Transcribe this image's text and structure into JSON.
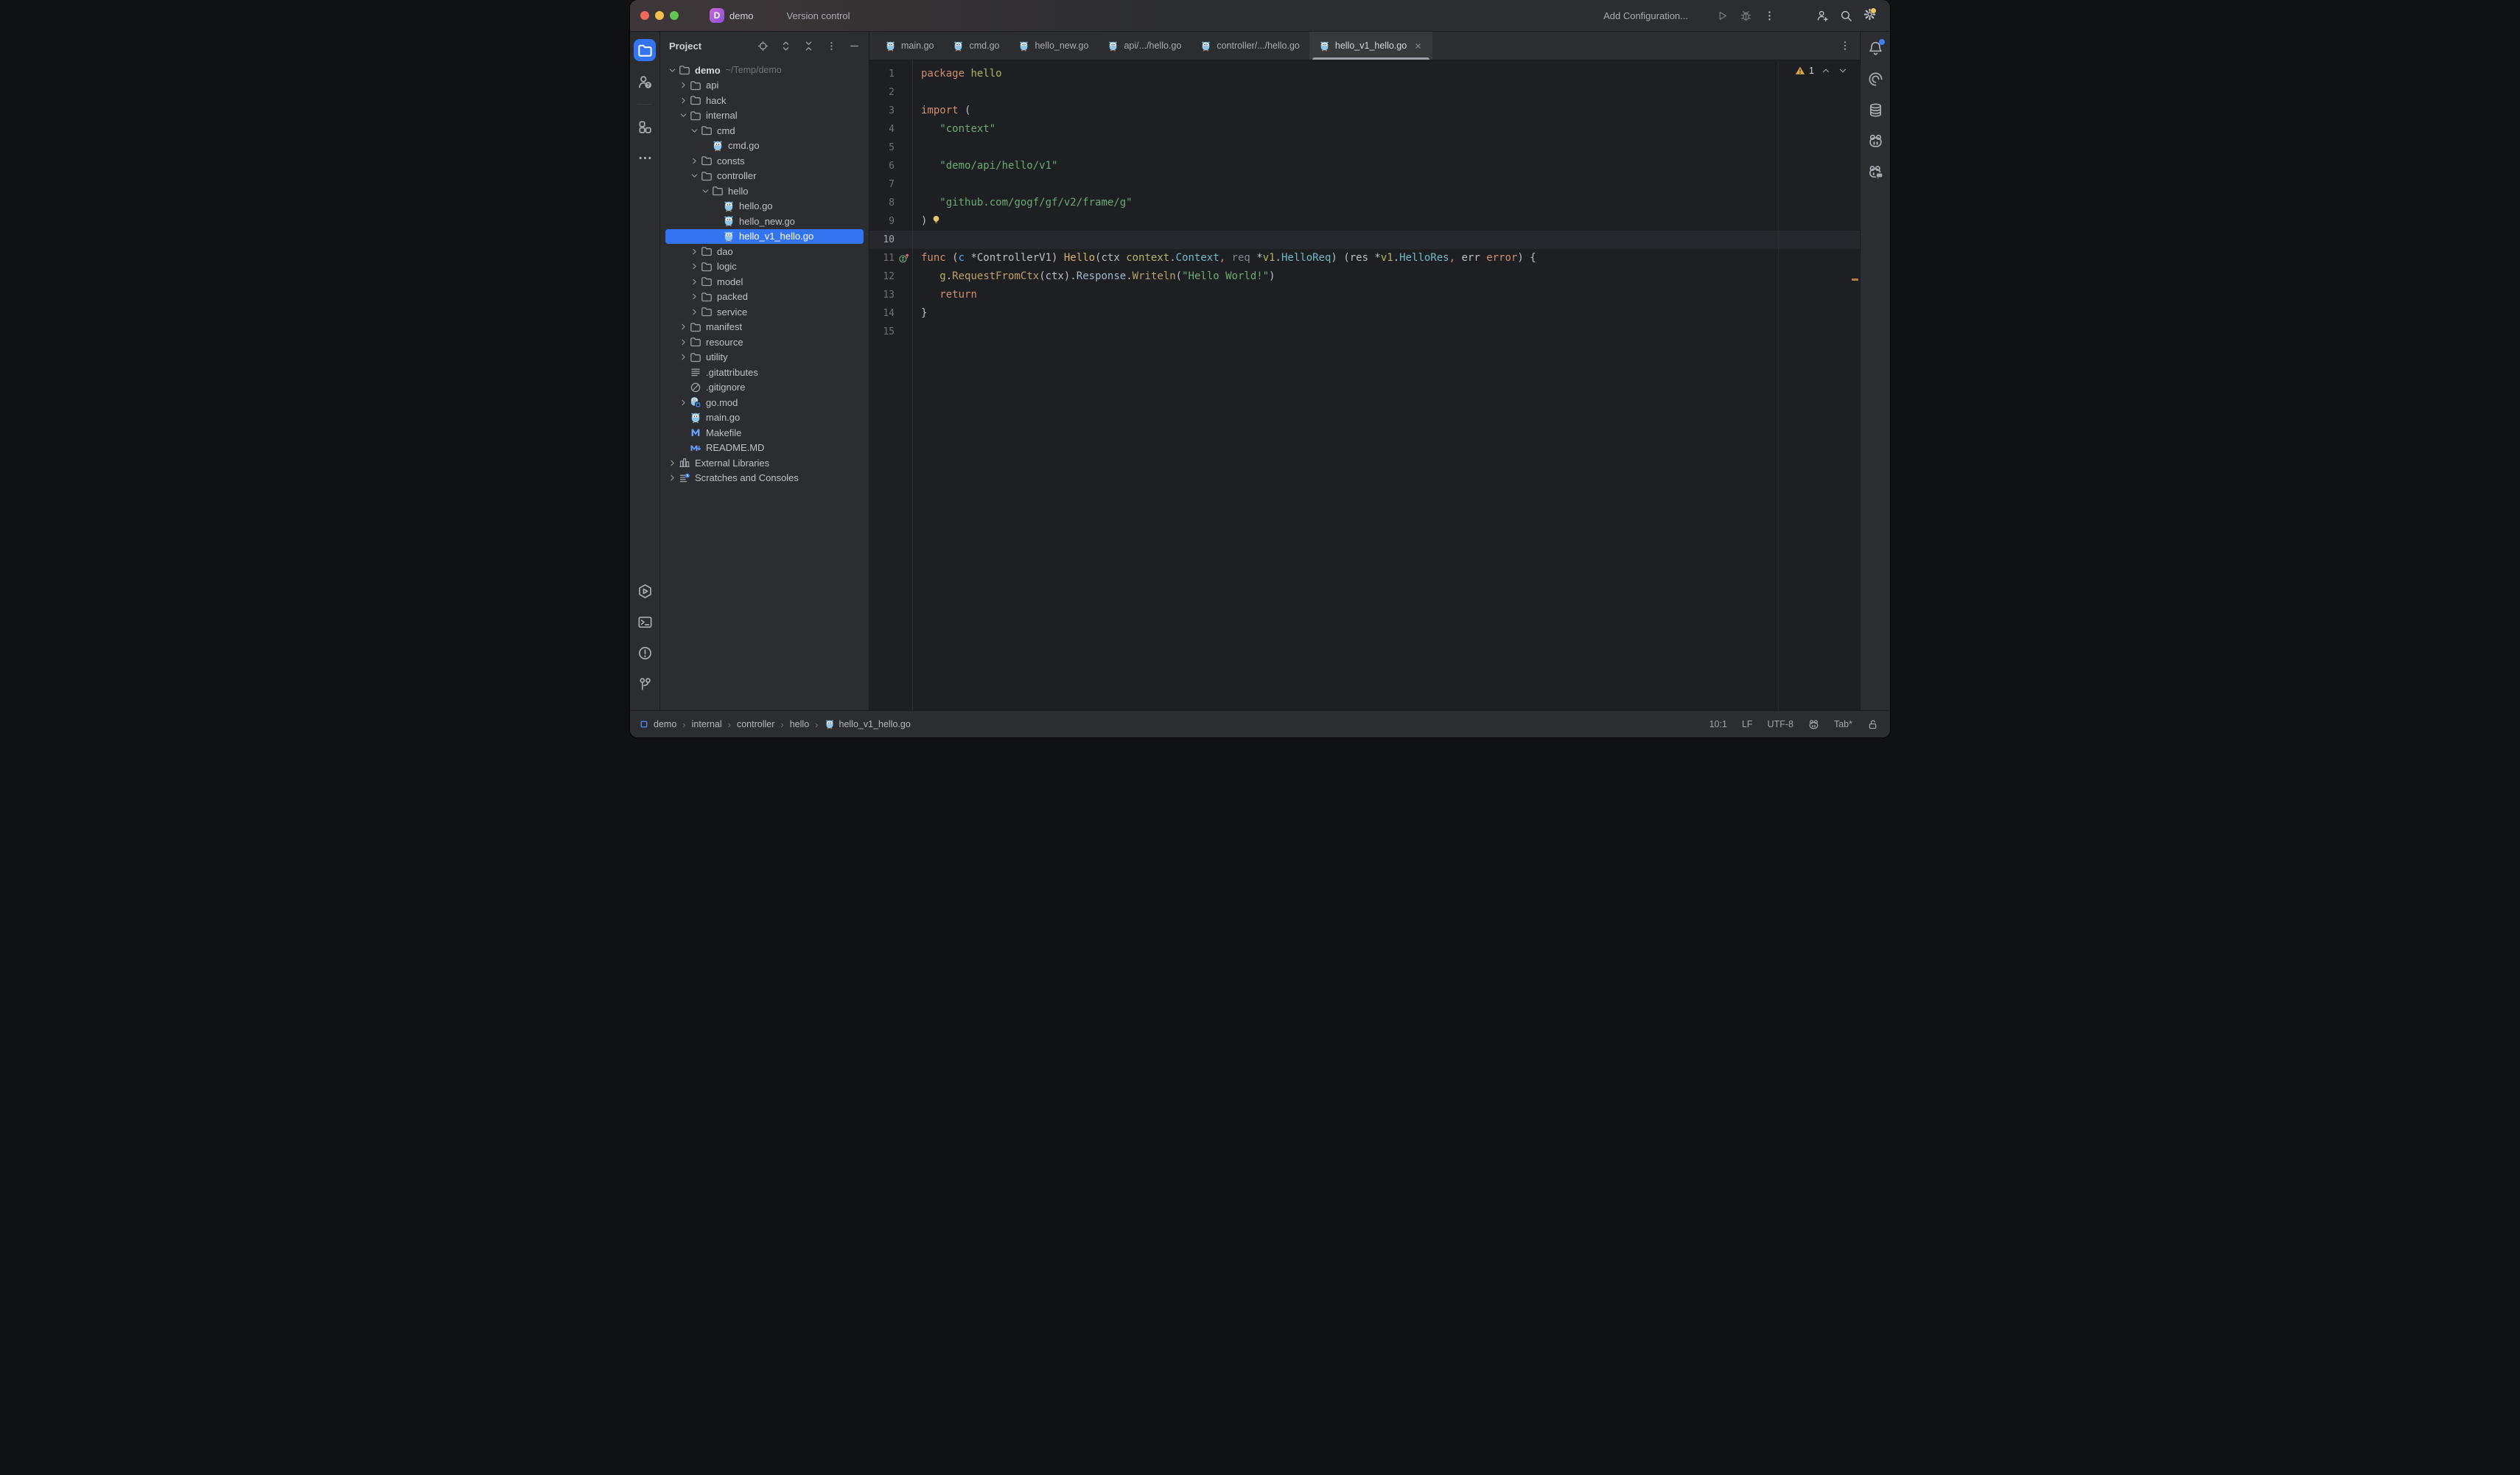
{
  "titlebar": {
    "avatar_letter": "D",
    "project_name": "demo",
    "vcs_menu": "Version control",
    "add_configuration": "Add Configuration..."
  },
  "project_panel": {
    "title": "Project",
    "tree": [
      {
        "label": "demo",
        "level": 0,
        "chevron": "down",
        "icon": "folder",
        "bold": true,
        "path": "~/Temp/demo"
      },
      {
        "label": "api",
        "level": 1,
        "chevron": "right",
        "icon": "folder"
      },
      {
        "label": "hack",
        "level": 1,
        "chevron": "right",
        "icon": "folder"
      },
      {
        "label": "internal",
        "level": 1,
        "chevron": "down",
        "icon": "folder"
      },
      {
        "label": "cmd",
        "level": 2,
        "chevron": "down",
        "icon": "folder"
      },
      {
        "label": "cmd.go",
        "level": 3,
        "icon": "gopher"
      },
      {
        "label": "consts",
        "level": 2,
        "chevron": "right",
        "icon": "folder"
      },
      {
        "label": "controller",
        "level": 2,
        "chevron": "down",
        "icon": "folder"
      },
      {
        "label": "hello",
        "level": 3,
        "chevron": "down",
        "icon": "folder"
      },
      {
        "label": "hello.go",
        "level": 4,
        "icon": "gopher"
      },
      {
        "label": "hello_new.go",
        "level": 4,
        "icon": "gopher"
      },
      {
        "label": "hello_v1_hello.go",
        "level": 4,
        "icon": "gopher",
        "selected": true
      },
      {
        "label": "dao",
        "level": 2,
        "chevron": "right",
        "icon": "folder"
      },
      {
        "label": "logic",
        "level": 2,
        "chevron": "right",
        "icon": "folder"
      },
      {
        "label": "model",
        "level": 2,
        "chevron": "right",
        "icon": "folder"
      },
      {
        "label": "packed",
        "level": 2,
        "chevron": "right",
        "icon": "folder"
      },
      {
        "label": "service",
        "level": 2,
        "chevron": "right",
        "icon": "folder"
      },
      {
        "label": "manifest",
        "level": 1,
        "chevron": "right",
        "icon": "folder"
      },
      {
        "label": "resource",
        "level": 1,
        "chevron": "right",
        "icon": "folder"
      },
      {
        "label": "utility",
        "level": 1,
        "chevron": "right",
        "icon": "folder"
      },
      {
        "label": ".gitattributes",
        "level": 1,
        "icon": "list"
      },
      {
        "label": ".gitignore",
        "level": 1,
        "icon": "ignore"
      },
      {
        "label": "go.mod",
        "level": 1,
        "chevron": "right",
        "icon": "gomod"
      },
      {
        "label": "main.go",
        "level": 1,
        "icon": "gopher"
      },
      {
        "label": "Makefile",
        "level": 1,
        "icon": "make"
      },
      {
        "label": "README.MD",
        "level": 1,
        "icon": "readme"
      },
      {
        "label": "External Libraries",
        "level": 0,
        "chevron": "right",
        "icon": "lib"
      },
      {
        "label": "Scratches and Consoles",
        "level": 0,
        "chevron": "right",
        "icon": "scratch"
      }
    ]
  },
  "tabs": {
    "items": [
      {
        "label": "main.go",
        "icon": "gopher"
      },
      {
        "label": "cmd.go",
        "icon": "gopher"
      },
      {
        "label": "hello_new.go",
        "icon": "gopher"
      },
      {
        "label": "api/.../hello.go",
        "icon": "gopher"
      },
      {
        "label": "controller/.../hello.go",
        "icon": "gopher"
      },
      {
        "label": "hello_v1_hello.go",
        "icon": "gopher",
        "active": true,
        "closable": true
      }
    ]
  },
  "editor": {
    "inspection_count": "1",
    "lines": [
      {
        "t": [
          [
            "package",
            "kw"
          ],
          [
            " ",
            "txt"
          ],
          [
            "hello",
            "pkg"
          ]
        ]
      },
      {
        "t": []
      },
      {
        "t": [
          [
            "import",
            "kw"
          ],
          [
            " (",
            "txt"
          ]
        ]
      },
      {
        "t": [
          [
            "   ",
            "txt"
          ],
          [
            "\"context\"",
            "str"
          ]
        ]
      },
      {
        "t": []
      },
      {
        "t": [
          [
            "   ",
            "txt"
          ],
          [
            "\"demo/api/hello/v1\"",
            "str"
          ]
        ]
      },
      {
        "t": []
      },
      {
        "t": [
          [
            "   ",
            "txt"
          ],
          [
            "\"github.com/gogf/gf/v2/frame/g\"",
            "str"
          ]
        ]
      },
      {
        "t": [
          [
            ")",
            "txt"
          ]
        ],
        "bulb": true
      },
      {
        "t": [],
        "hl": true
      },
      {
        "t": [
          [
            "func",
            "kw"
          ],
          [
            " (",
            "txt"
          ],
          [
            "c",
            "prm"
          ],
          [
            " *ControllerV1) ",
            "txt"
          ],
          [
            "Hello",
            "fn"
          ],
          [
            "(ctx ",
            "txt"
          ],
          [
            "context",
            "pkg"
          ],
          [
            ".",
            "txt"
          ],
          [
            "Context",
            "typ"
          ],
          [
            ",",
            "kw"
          ],
          [
            " ",
            "txt"
          ],
          [
            "req",
            "dim"
          ],
          [
            " *",
            "txt"
          ],
          [
            "v1",
            "pkg"
          ],
          [
            ".",
            "txt"
          ],
          [
            "HelloReq",
            "typ"
          ],
          [
            ") (res *",
            "txt"
          ],
          [
            "v1",
            "pkg"
          ],
          [
            ".",
            "txt"
          ],
          [
            "HelloRes",
            "typ"
          ],
          [
            ",",
            "kw"
          ],
          [
            " err ",
            "txt"
          ],
          [
            "error",
            "kw"
          ],
          [
            ") {",
            "txt"
          ]
        ],
        "g": "impl"
      },
      {
        "t": [
          [
            "   ",
            "txt"
          ],
          [
            "g",
            "pkg"
          ],
          [
            ".",
            "txt"
          ],
          [
            "RequestFromCtx",
            "mth"
          ],
          [
            "(ctx)",
            "txt"
          ],
          [
            ".",
            "txt"
          ],
          [
            "Response",
            "fld"
          ],
          [
            ".",
            "txt"
          ],
          [
            "Writeln",
            "mth"
          ],
          [
            "(",
            "txt"
          ],
          [
            "\"Hello World!\"",
            "str"
          ],
          [
            ")",
            "txt"
          ]
        ]
      },
      {
        "t": [
          [
            "   ",
            "txt"
          ],
          [
            "return",
            "kw"
          ]
        ]
      },
      {
        "t": [
          [
            "}",
            "txt"
          ]
        ]
      },
      {
        "t": []
      }
    ]
  },
  "status_bar": {
    "breadcrumbs": [
      "demo",
      "internal",
      "controller",
      "hello",
      "hello_v1_hello.go"
    ],
    "caret": "10:1",
    "line_sep": "LF",
    "encoding": "UTF-8",
    "indent": "Tab*"
  },
  "colors": {
    "accent": "#3574F0",
    "kw": "#CF8E6D",
    "str": "#6AAB73",
    "pkg": "#B2B465",
    "typ": "#6CBAC8",
    "fn": "#D5B06A",
    "mth": "#BCA06A",
    "fld": "#A3B7CC",
    "prm": "#56A8F5",
    "dim": "#7F848D",
    "txt": "#BCBEC4"
  }
}
